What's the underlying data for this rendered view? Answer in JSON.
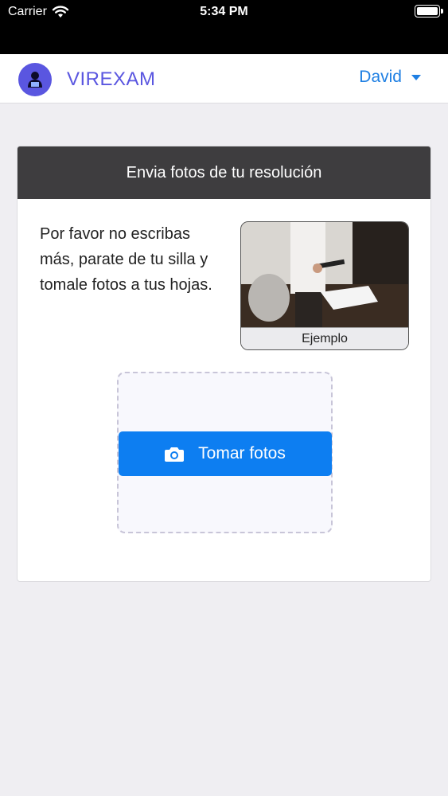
{
  "status_bar": {
    "carrier": "Carrier",
    "time": "5:34 PM"
  },
  "navbar": {
    "brand": "VIREXAM",
    "user": "David"
  },
  "card": {
    "header": "Envia fotos de tu resolución",
    "instructions": "Por favor no escribas más, parate de tu silla y tomale fotos a tus hojas.",
    "example_caption": "Ejemplo",
    "take_photos_label": "Tomar fotos"
  },
  "colors": {
    "brand": "#5a56e0",
    "link": "#1e7fe3",
    "primary_button": "#0d7ef1",
    "card_header": "#3e3d3f"
  },
  "icons": {
    "wifi": "wifi-icon",
    "battery": "battery-icon",
    "dropdown": "caret-down-icon",
    "camera": "camera-icon"
  }
}
